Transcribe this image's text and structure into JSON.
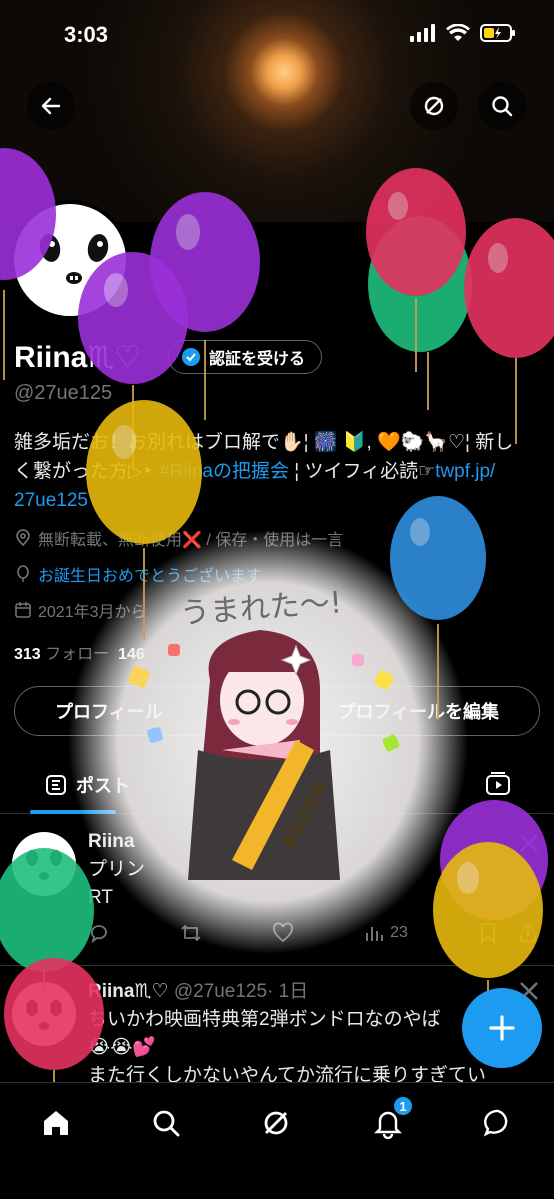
{
  "status_bar": {
    "time": "3:03"
  },
  "profile": {
    "name": "Riina♏︎♡",
    "verify_label": "認証を受ける",
    "handle": "@27ue125",
    "bio_line1": "雑多垢だお！お別れはブロ解で✋🏻¦ 🎆 🔰, 🧡🐑🦙♡¦ 新し",
    "bio_line2_a": "く繋がった方▷‣ ",
    "bio_line2_link": "#Riinaの把握会",
    "bio_line2_b": " ¦ ツイフィ必読☞",
    "bio_link1": "twpf.jp/",
    "bio_link2": "27ue125",
    "meta_location": "無断転載、無断使用❌ / 保存・使用は一言",
    "meta_birthday": "お誕生日おめでとうございます",
    "meta_joined": "2021年3月から",
    "following_count": "313",
    "following_label": "フォロー",
    "followers_count": "146",
    "edit_left": "プロフィール",
    "edit_right": "プロフィールを編集"
  },
  "tabs": {
    "posts": "ポスト"
  },
  "posts": [
    {
      "name": "Riina",
      "line1": "プリン",
      "line2": "RT",
      "views": "23"
    },
    {
      "name": "Riina♏︎♡",
      "handle": "@27ue125",
      "time": "· 1日",
      "line1": "ちいかわ映画特典第2弾ボンドロなのやば",
      "line2": "😭😭💕",
      "line3": "また行くしかないやんてか流行に乗りすぎてい"
    }
  ],
  "overlay": {
    "sticker_text": "うまれた〜!",
    "sash_text": "本日の主役"
  },
  "nav": {
    "notifications_badge": "1"
  },
  "icons": [
    "back-arrow-icon",
    "no-sign-icon",
    "search-icon",
    "verified-badge-icon",
    "location-icon",
    "balloon-icon",
    "calendar-icon",
    "media-tab-icon",
    "home-icon",
    "grok-icon",
    "bell-icon",
    "messages-icon",
    "plus-icon",
    "reply-icon",
    "retweet-icon",
    "like-icon",
    "views-icon",
    "bookmark-icon",
    "share-icon",
    "x-logo-icon"
  ],
  "colors": {
    "accent": "#1d9bf0",
    "background": "#000000",
    "muted": "#71767b"
  }
}
